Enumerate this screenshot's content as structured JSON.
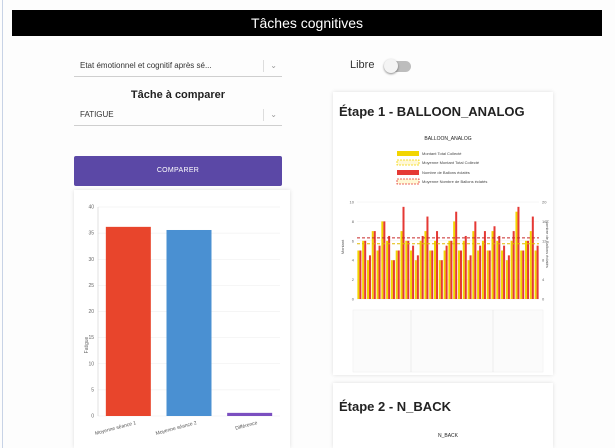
{
  "header": {
    "title": "Tâches cognitives"
  },
  "left": {
    "state_select": {
      "value": "Etat émotionnel et cognitif après sé..."
    },
    "compare_label": "Tâche à comparer",
    "task_select": {
      "value": "FATIGUE"
    },
    "compare_button": "COMPARER"
  },
  "right": {
    "free_toggle": {
      "label": "Libre",
      "on": false
    },
    "step1": {
      "title": "Étape 1 - BALLOON_ANALOG",
      "subtitle": "BALLOON_ANALOG"
    },
    "step2": {
      "title": "Étape 2 - N_BACK",
      "subtitle": "N_BACK"
    }
  },
  "chart_data": [
    {
      "type": "bar",
      "title": "",
      "ylabel": "Fatigue",
      "xlabel": "",
      "ylim": [
        0,
        40
      ],
      "yticks": [
        0,
        5,
        10,
        15,
        20,
        25,
        30,
        35,
        40
      ],
      "categories": [
        "Moyenne séance 1",
        "Moyenne séance 2",
        "Différence"
      ],
      "values": [
        36.2,
        35.6,
        0.6
      ],
      "colors": [
        "#e8452c",
        "#4a90d2",
        "#7b4fc0"
      ]
    },
    {
      "type": "bar",
      "title": "BALLOON_ANALOG",
      "legend": [
        {
          "name": "Montant Total Collecté",
          "color": "#f2d500",
          "kind": "bar"
        },
        {
          "name": "Moyenne Montant Total Collecté",
          "color": "#f2d500",
          "kind": "dashed"
        },
        {
          "name": "Nombre de Ballons éclatés",
          "color": "#e53935",
          "kind": "bar"
        },
        {
          "name": "Moyenne Nombre de Ballons éclatés",
          "color": "#e53935",
          "kind": "dashed"
        }
      ],
      "ylabel_left": "Montant",
      "ylabel_right": "Nombre de Ballons éclatés",
      "y_left_ticks": [
        0,
        2,
        4,
        6,
        8,
        10
      ],
      "y_right_ticks": [
        0,
        4,
        8,
        12,
        16,
        20
      ],
      "y_left_range": [
        0,
        10
      ],
      "y_right_range": [
        0,
        20
      ],
      "series": [
        {
          "name": "Montant Total Collecté",
          "axis": "left",
          "values": [
            5,
            6,
            4,
            7,
            5,
            8,
            6,
            4,
            5,
            7,
            6,
            5,
            4,
            6,
            7,
            5,
            6,
            4,
            5,
            6,
            8,
            5,
            6,
            4,
            7,
            5,
            6,
            5,
            7,
            6,
            5,
            4,
            6,
            9,
            5,
            6,
            7,
            5
          ]
        },
        {
          "name": "Nombre de Ballons éclatés",
          "axis": "right",
          "values": [
            10,
            12,
            9,
            14,
            11,
            16,
            13,
            8,
            10,
            19,
            12,
            11,
            9,
            13,
            17,
            10,
            14,
            8,
            11,
            12,
            18,
            10,
            13,
            9,
            16,
            11,
            14,
            10,
            15,
            13,
            11,
            9,
            14,
            19,
            10,
            12,
            17,
            11
          ]
        }
      ],
      "means": {
        "left": 5.7,
        "right": 12.6
      }
    }
  ]
}
